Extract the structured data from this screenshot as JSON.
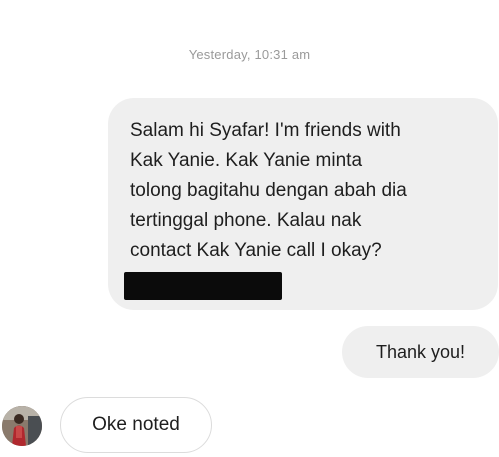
{
  "thread": {
    "timestamp": "Yesterday, 10:31 am",
    "messages": [
      {
        "direction": "outgoing",
        "text": "Salam hi Syafar! I'm friends with\nKak Yanie. Kak Yanie minta\ntolong bagitahu dengan abah dia\ntertinggal phone. Kalau nak\ncontact Kak Yanie call I okay?",
        "redacted": true
      },
      {
        "direction": "outgoing",
        "text": "Thank you!"
      },
      {
        "direction": "incoming",
        "text": "Oke noted"
      }
    ]
  },
  "colors": {
    "outgoing_bubble": "#efefef",
    "incoming_border": "#dcdcdc",
    "timestamp": "#9a9a9a",
    "redaction": "#0b0b0b"
  }
}
